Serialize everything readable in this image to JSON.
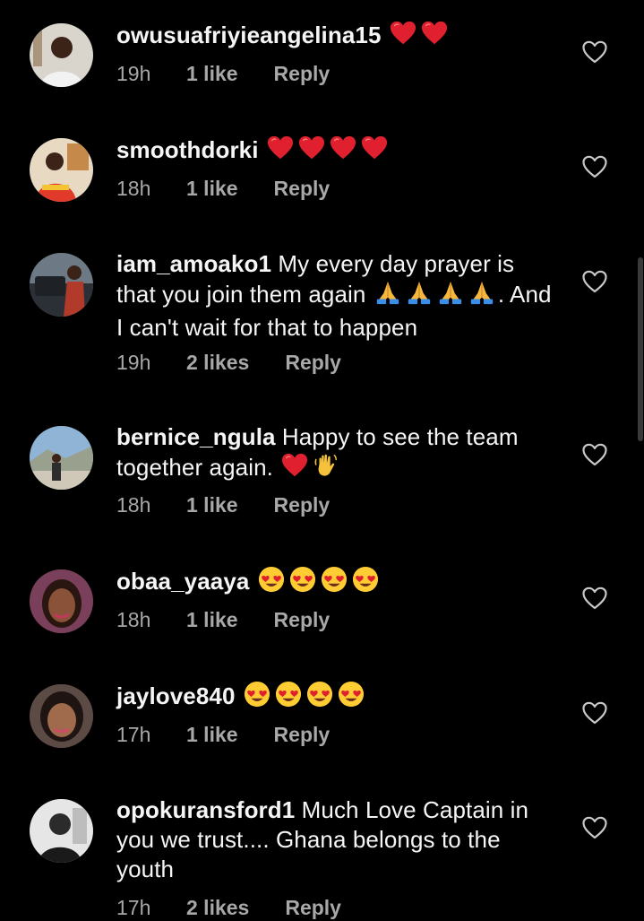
{
  "comments": [
    {
      "username": "owusuafriyieangelina15",
      "text": "",
      "emoji": [
        "red-heart",
        "red-heart"
      ],
      "time": "19h",
      "likes": "1 like",
      "reply": "Reply"
    },
    {
      "username": "smoothdorki",
      "text": "",
      "emoji": [
        "red-heart",
        "red-heart",
        "red-heart",
        "red-heart"
      ],
      "time": "18h",
      "likes": "1 like",
      "reply": "Reply"
    },
    {
      "username": "iam_amoako1",
      "text_part1": "My every day prayer is that you join them again",
      "emoji": [
        "folded-hands",
        "folded-hands",
        "folded-hands",
        "folded-hands"
      ],
      "text_part2": ". And I can't wait for that to happen",
      "time": "19h",
      "likes": "2 likes",
      "reply": "Reply"
    },
    {
      "username": "bernice_ngula",
      "text": "Happy to see the team together again.",
      "emoji": [
        "red-heart",
        "waving-hand"
      ],
      "time": "18h",
      "likes": "1 like",
      "reply": "Reply"
    },
    {
      "username": "obaa_yaaya",
      "text": "",
      "emoji": [
        "heart-eyes",
        "heart-eyes",
        "heart-eyes",
        "heart-eyes"
      ],
      "time": "18h",
      "likes": "1 like",
      "reply": "Reply"
    },
    {
      "username": "jaylove840",
      "text": "",
      "emoji": [
        "heart-eyes",
        "heart-eyes",
        "heart-eyes",
        "heart-eyes"
      ],
      "time": "17h",
      "likes": "1 like",
      "reply": "Reply"
    },
    {
      "username": "opokuransford1",
      "text": "Much Love Captain in you we trust.... Ghana belongs to the youth",
      "emoji": [],
      "time": "17h",
      "likes": "2 likes",
      "reply": "Reply"
    }
  ],
  "colors": {
    "background": "#000000",
    "text": "#f5f5f5",
    "meta": "#a8a8a8",
    "heart_emoji": "#e0202e",
    "like_icon": "#c8c8c8"
  },
  "icons": {
    "like": "heart-outline-icon"
  }
}
